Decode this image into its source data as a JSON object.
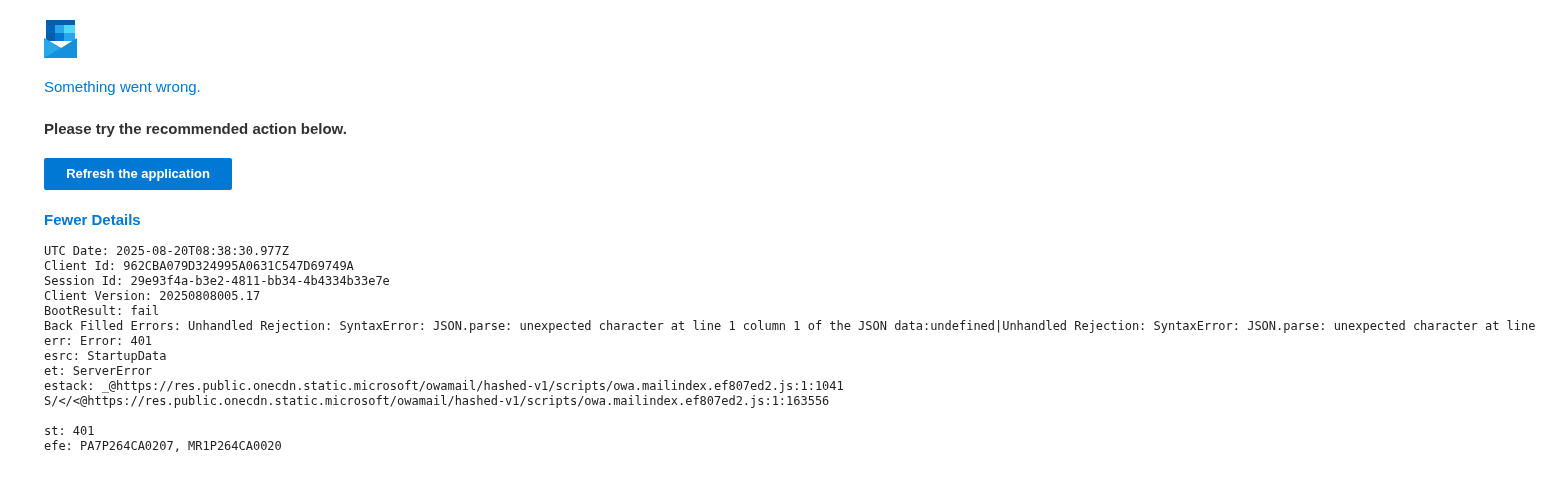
{
  "error_title": "Something went wrong.",
  "instruction": "Please try the recommended action below.",
  "action_button": "Refresh the application",
  "details_toggle": "Fewer Details",
  "details_blocks": [
    [
      "UTC Date: 2025-08-20T08:38:30.977Z",
      "Client Id: 962CBA079D324995A0631C547D69749A",
      "Session Id: 29e93f4a-b3e2-4811-bb34-4b4334b33e7e",
      "Client Version: 20250808005.17",
      "BootResult: fail",
      "Back Filled Errors: Unhandled Rejection: SyntaxError: JSON.parse: unexpected character at line 1 column 1 of the JSON data:undefined|Unhandled Rejection: SyntaxError: JSON.parse: unexpected character at line",
      "err: Error: 401",
      "esrc: StartupData",
      "et: ServerError",
      "estack: _@https://res.public.onecdn.static.microsoft/owamail/hashed-v1/scripts/owa.mailindex.ef807ed2.js:1:1041",
      "S/</<@https://res.public.onecdn.static.microsoft/owamail/hashed-v1/scripts/owa.mailindex.ef807ed2.js:1:163556"
    ],
    [
      "st: 401",
      "efe: PA7P264CA0207, MR1P264CA0020"
    ]
  ]
}
